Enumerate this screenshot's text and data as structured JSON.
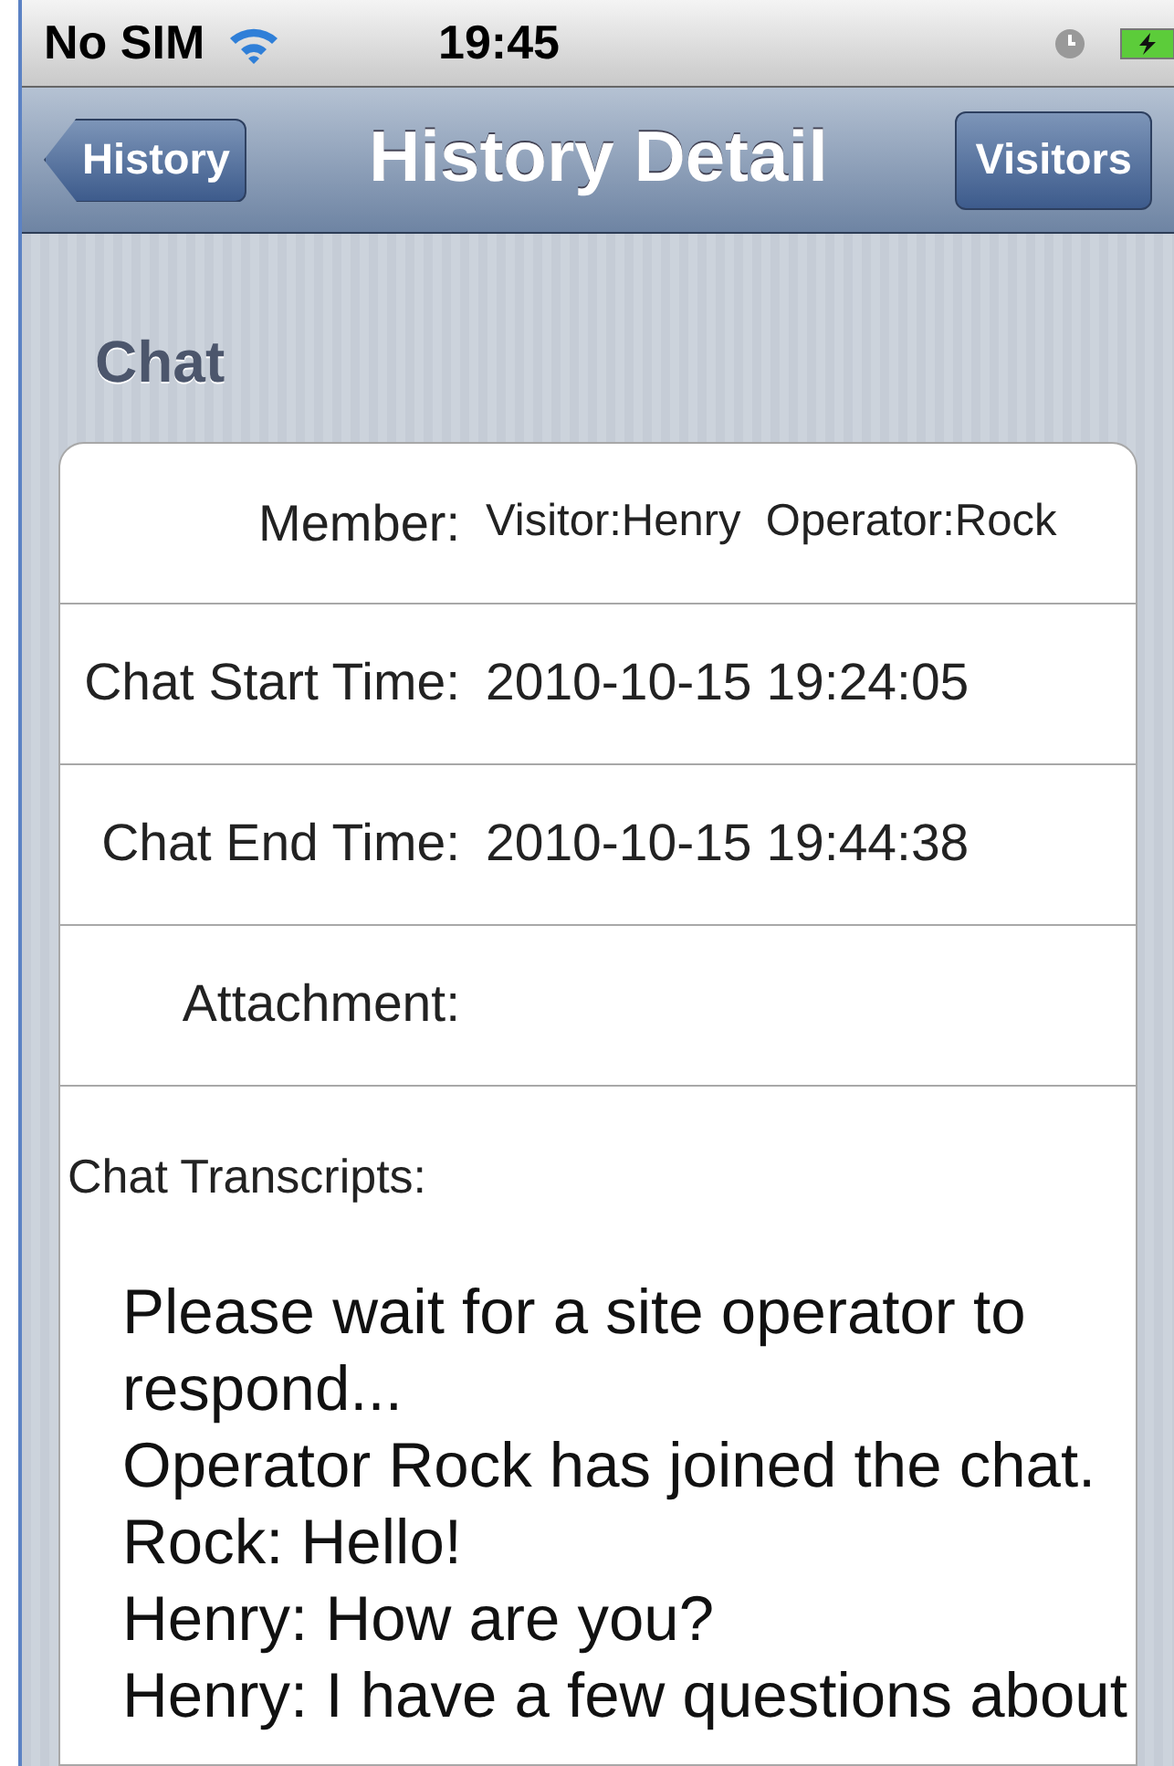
{
  "status_bar": {
    "carrier": "No SIM",
    "time": "19:45"
  },
  "nav_bar": {
    "back_button": "History",
    "title": "History Detail",
    "right_button": "Visitors"
  },
  "section": {
    "header": "Chat",
    "fields": [
      {
        "label": "Member:",
        "value": "Visitor:Henry  Operator:Rock",
        "kind": "small"
      },
      {
        "label": "Chat Start Time:",
        "value": "2010-10-15 19:24:05",
        "kind": "normal"
      },
      {
        "label": "Chat End Time:",
        "value": "2010-10-15 19:44:38",
        "kind": "normal"
      },
      {
        "label": "Attachment:",
        "kind": "normal"
      }
    ],
    "transcript": {
      "label": "Chat Transcripts:",
      "lines": [
        "Please wait for a site operator to respond...",
        "Operator Rock has joined the chat.",
        "Rock: Hello!",
        "Henry: How are you?",
        "Henry: I have a few questions about"
      ]
    }
  }
}
